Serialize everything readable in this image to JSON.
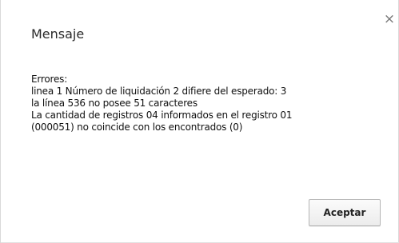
{
  "dialog": {
    "title": "Mensaje",
    "close_glyph": "×",
    "message_lines": [
      "Errores:",
      "linea 1 Número de liquidación 2 difiere del esperado: 3",
      "la línea 536 no posee 51 caracteres",
      "La cantidad de registros 04 informados en el registro 01",
      "(000051) no coincide con los encontrados (0)"
    ],
    "accept_label": "Aceptar"
  }
}
